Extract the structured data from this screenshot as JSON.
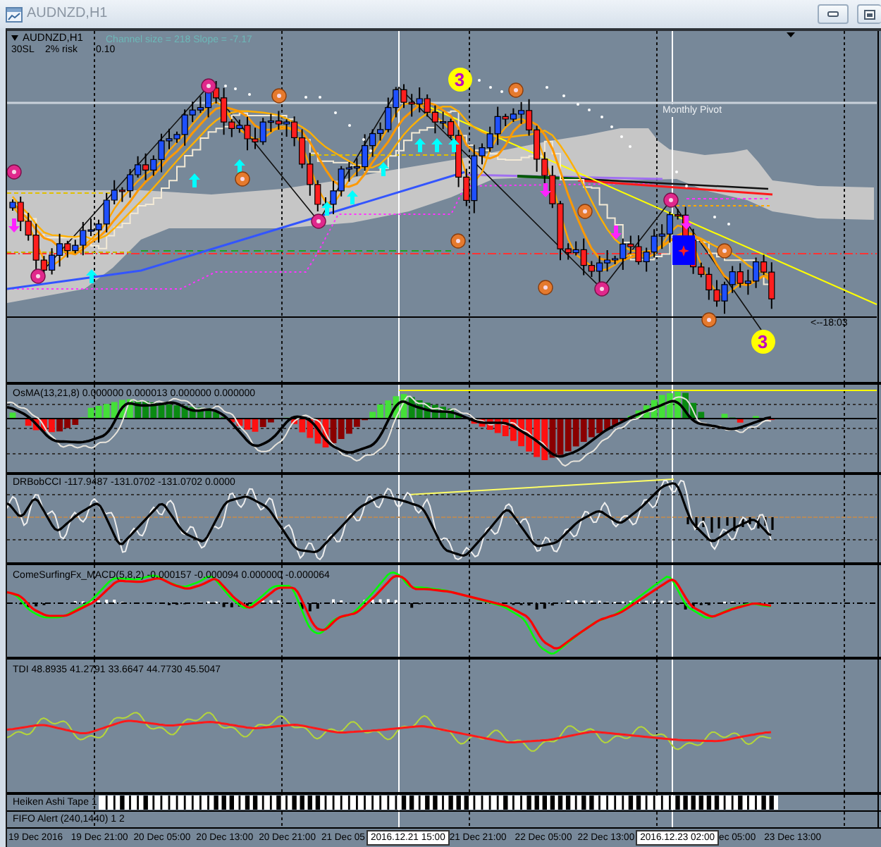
{
  "window": {
    "title": "AUDNZD,H1"
  },
  "main_chart": {
    "symbol": "AUDNZD,H1",
    "trade_info": [
      "30SL",
      "2% risk",
      "0.10"
    ],
    "channel_info": "Channel size = 218 Slope = -7.17",
    "pivot_label": "Monthly Pivot",
    "countdown": "<--18:03",
    "wave_marks": [
      "3",
      "3"
    ]
  },
  "indicators": [
    {
      "kind": "osma",
      "label": "OsMA(13,21,8) 0.000000 0.000013 0.000000 0.000000"
    },
    {
      "kind": "cci",
      "label": "DRBobCCI -117.9487 -131.0702 -131.0702 0.0000"
    },
    {
      "kind": "macd",
      "label": "ComeSurfingFx_MACD(5,8,2) -0.000157 -0.000094 0.000000 -0.000064"
    },
    {
      "kind": "tdi",
      "label": "TDI 48.8935 41.2791 33.6647 44.7730 45.5047"
    },
    {
      "kind": "tape",
      "label": "Heiken Ashi Tape 1"
    },
    {
      "kind": "alert",
      "label": "FIFO Alert (240,1440) 1 2"
    }
  ],
  "time_axis": [
    {
      "kind": "tick",
      "label": "19 Dec 2016"
    },
    {
      "kind": "tick",
      "label": "19 Dec 21:00"
    },
    {
      "kind": "tick",
      "label": "20 Dec 05:00"
    },
    {
      "kind": "tick",
      "label": "20 Dec 13:00"
    },
    {
      "kind": "tick",
      "label": "20 Dec 21:00"
    },
    {
      "kind": "tick",
      "label": "21 Dec 05"
    },
    {
      "kind": "cursor",
      "label": "2016.12.21 15:00"
    },
    {
      "kind": "tick",
      "label": "21 Dec 21:00"
    },
    {
      "kind": "tick",
      "label": "22 Dec 05:00"
    },
    {
      "kind": "tick",
      "label": "22 Dec 13:00"
    },
    {
      "kind": "cursor",
      "label": "2016.12.23 02:00"
    },
    {
      "kind": "tick",
      "label": "ec 05:00"
    },
    {
      "kind": "tick",
      "label": "23 Dec 13:00"
    }
  ]
}
